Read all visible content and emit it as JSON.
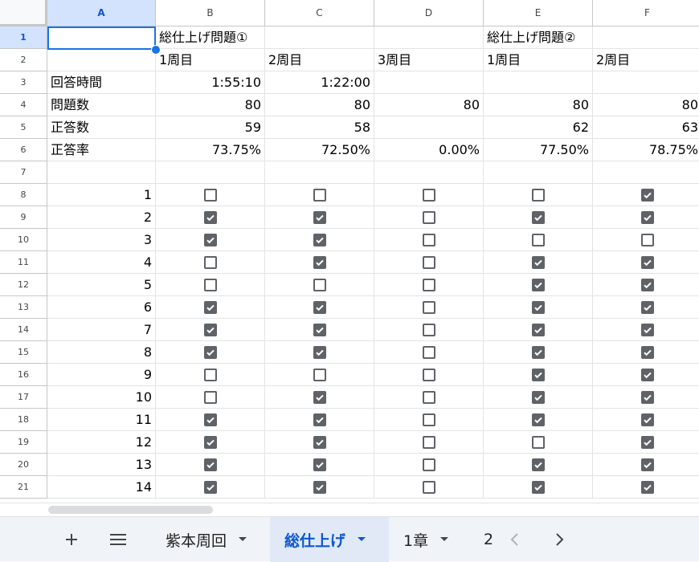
{
  "columns": [
    "A",
    "B",
    "C",
    "D",
    "E",
    "F"
  ],
  "selected_column": "A",
  "selected_row": 1,
  "rows": [
    {
      "num": "1",
      "cells": [
        "",
        "総仕上げ問題①",
        "",
        "",
        "総仕上げ問題②",
        ""
      ]
    },
    {
      "num": "2",
      "cells": [
        "",
        "1周目",
        "2周目",
        "3周目",
        "1周目",
        "2周目"
      ]
    },
    {
      "num": "3",
      "cells": [
        "回答時間",
        "1:55:10",
        "1:22:00",
        "",
        "",
        ""
      ]
    },
    {
      "num": "4",
      "cells": [
        "問題数",
        "80",
        "80",
        "80",
        "80",
        "80"
      ]
    },
    {
      "num": "5",
      "cells": [
        "正答数",
        "59",
        "58",
        "",
        "62",
        "63"
      ]
    },
    {
      "num": "6",
      "cells": [
        "正答率",
        "73.75%",
        "72.50%",
        "0.00%",
        "77.50%",
        "78.75%"
      ]
    },
    {
      "num": "7",
      "cells": [
        "",
        "",
        "",
        "",
        "",
        ""
      ]
    }
  ],
  "checkbox_rows": [
    {
      "num": "8",
      "label": "1",
      "checks": [
        false,
        false,
        false,
        false,
        true
      ]
    },
    {
      "num": "9",
      "label": "2",
      "checks": [
        true,
        true,
        false,
        true,
        true
      ]
    },
    {
      "num": "10",
      "label": "3",
      "checks": [
        true,
        true,
        false,
        false,
        false
      ]
    },
    {
      "num": "11",
      "label": "4",
      "checks": [
        false,
        true,
        false,
        true,
        true
      ]
    },
    {
      "num": "12",
      "label": "5",
      "checks": [
        false,
        false,
        false,
        true,
        true
      ]
    },
    {
      "num": "13",
      "label": "6",
      "checks": [
        true,
        true,
        false,
        true,
        true
      ]
    },
    {
      "num": "14",
      "label": "7",
      "checks": [
        true,
        true,
        false,
        true,
        true
      ]
    },
    {
      "num": "15",
      "label": "8",
      "checks": [
        true,
        true,
        false,
        true,
        true
      ]
    },
    {
      "num": "16",
      "label": "9",
      "checks": [
        false,
        false,
        false,
        true,
        true
      ]
    },
    {
      "num": "17",
      "label": "10",
      "checks": [
        false,
        true,
        false,
        true,
        true
      ]
    },
    {
      "num": "18",
      "label": "11",
      "checks": [
        true,
        true,
        false,
        true,
        true
      ]
    },
    {
      "num": "19",
      "label": "12",
      "checks": [
        true,
        true,
        false,
        false,
        true
      ]
    },
    {
      "num": "20",
      "label": "13",
      "checks": [
        true,
        true,
        false,
        true,
        true
      ]
    },
    {
      "num": "21",
      "label": "14",
      "checks": [
        true,
        true,
        false,
        true,
        true
      ]
    }
  ],
  "number_cols": [
    1,
    2,
    3,
    4,
    5
  ],
  "sheet_tabs": {
    "add_icon": "plus-icon",
    "menu_icon": "menu-icon",
    "tabs": [
      {
        "label": "紫本周回",
        "active": false
      },
      {
        "label": "総仕上げ",
        "active": true
      },
      {
        "label": "1章",
        "active": false
      },
      {
        "label": "2",
        "active": false
      }
    ],
    "prev_icon": "chevron-left-icon",
    "next_icon": "chevron-right-icon"
  },
  "colors": {
    "accent": "#1a73e8",
    "header_selected_bg": "#d3e3fd",
    "checkbox_checked": "#5f6368",
    "tab_active_text": "#0b57d0"
  }
}
